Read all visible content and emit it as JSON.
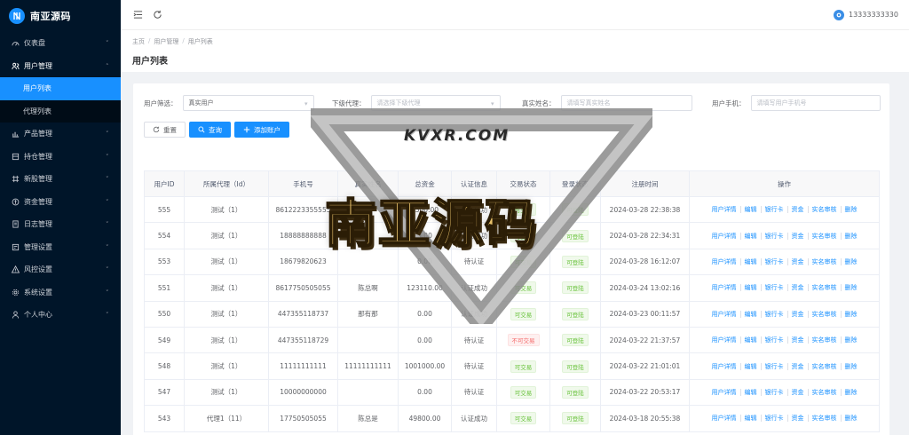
{
  "brand": {
    "name": "南亚源码"
  },
  "sidebar": {
    "items": [
      {
        "label": "仪表盘",
        "icon": "dashboard-icon"
      },
      {
        "label": "用户管理",
        "icon": "users-icon",
        "open": true,
        "children": [
          {
            "label": "用户列表",
            "active": true
          },
          {
            "label": "代理列表"
          }
        ]
      },
      {
        "label": "产品管理",
        "icon": "chart-icon"
      },
      {
        "label": "持仓管理",
        "icon": "box-icon"
      },
      {
        "label": "新股管理",
        "icon": "grid-icon"
      },
      {
        "label": "资金管理",
        "icon": "coin-icon"
      },
      {
        "label": "日志管理",
        "icon": "log-icon"
      },
      {
        "label": "管理设置",
        "icon": "settings-panel-icon"
      },
      {
        "label": "风控设置",
        "icon": "warning-icon"
      },
      {
        "label": "系统设置",
        "icon": "gear-icon"
      },
      {
        "label": "个人中心",
        "icon": "person-icon"
      }
    ]
  },
  "header": {
    "user": "13333333330"
  },
  "breadcrumb": [
    "主页",
    "用户管理",
    "用户列表"
  ],
  "page": {
    "title": "用户列表"
  },
  "filters": {
    "user_filter": {
      "label": "用户筛选：",
      "value": "真实用户"
    },
    "sub_agent": {
      "label": "下级代理：",
      "placeholder": "请选择下级代理"
    },
    "real_name": {
      "label": "真实姓名：",
      "placeholder": "请填写真实姓名"
    },
    "phone": {
      "label": "用户手机：",
      "placeholder": "请填写用户手机号"
    }
  },
  "buttons": {
    "reset": "重置",
    "search": "查询",
    "add": "添加账户"
  },
  "table": {
    "columns": [
      "用户ID",
      "所属代理（Id）",
      "手机号",
      "真实姓名",
      "总资金",
      "认证信息",
      "交易状态",
      "登录状态",
      "注册时间",
      "操作"
    ],
    "ops": [
      "用户详情",
      "编辑",
      "银行卡",
      "资金",
      "实名审核",
      "删除"
    ],
    "rows": [
      {
        "id": "555",
        "agent": "测试（1）",
        "phone": "8612223355555",
        "name": "",
        "funds": "1500.00",
        "auth": "认证成功",
        "trade": "可交易",
        "trade_ok": true,
        "login": "可登陆",
        "time": "2024-03-28 22:38:38"
      },
      {
        "id": "554",
        "agent": "测试（1）",
        "phone": "18888888888",
        "name": "",
        "funds": "0.00",
        "auth": "认证成功",
        "trade": "可交易",
        "trade_ok": true,
        "login": "可登陆",
        "time": "2024-03-28 22:34:31"
      },
      {
        "id": "553",
        "agent": "测试（1）",
        "phone": "18679820623",
        "name": "",
        "funds": "0.00",
        "auth": "待认证",
        "trade": "可交易",
        "trade_ok": true,
        "login": "可登陆",
        "time": "2024-03-28 16:12:07"
      },
      {
        "id": "551",
        "agent": "测试（1）",
        "phone": "8617750505055",
        "name": "陈总啊",
        "funds": "123110.00",
        "auth": "认证成功",
        "trade": "可交易",
        "trade_ok": true,
        "login": "可登陆",
        "time": "2024-03-24 13:02:16"
      },
      {
        "id": "550",
        "agent": "测试（1）",
        "phone": "447355118737",
        "name": "那有那",
        "funds": "0.00",
        "auth": "认证成功",
        "trade": "可交易",
        "trade_ok": true,
        "login": "可登陆",
        "time": "2024-03-23 00:11:57"
      },
      {
        "id": "549",
        "agent": "测试（1）",
        "phone": "447355118729",
        "name": "",
        "funds": "0.00",
        "auth": "待认证",
        "trade": "不可交易",
        "trade_ok": false,
        "login": "可登陆",
        "time": "2024-03-22 21:37:57"
      },
      {
        "id": "548",
        "agent": "测试（1）",
        "phone": "11111111111",
        "name": "11111111111",
        "funds": "1001000.00",
        "auth": "待认证",
        "trade": "可交易",
        "trade_ok": true,
        "login": "可登陆",
        "time": "2024-03-22 21:01:01"
      },
      {
        "id": "547",
        "agent": "测试（1）",
        "phone": "10000000000",
        "name": "",
        "funds": "0.00",
        "auth": "待认证",
        "trade": "可交易",
        "trade_ok": true,
        "login": "可登陆",
        "time": "2024-03-22 20:53:17"
      },
      {
        "id": "543",
        "agent": "代理1（11）",
        "phone": "17750505055",
        "name": "陈总是",
        "funds": "49800.00",
        "auth": "认证成功",
        "trade": "可交易",
        "trade_ok": true,
        "login": "可登陆",
        "time": "2024-03-18 20:55:38"
      }
    ]
  },
  "watermark": {
    "caption": "KVXR.COM",
    "title": "南亚源码"
  },
  "colors": {
    "sidebar_bg": "#001529",
    "accent": "#1890ff",
    "success": "#67c23a",
    "danger": "#f56c6c"
  }
}
